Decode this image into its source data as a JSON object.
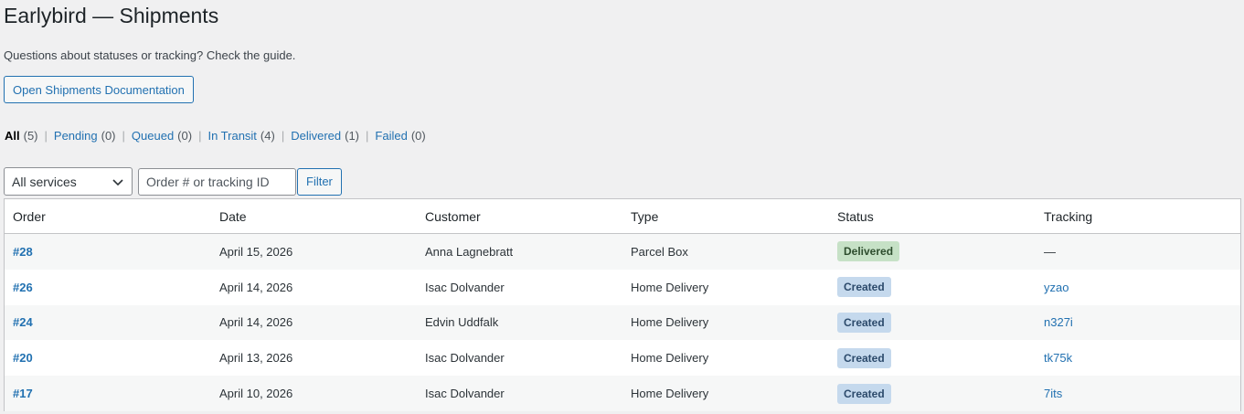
{
  "header": {
    "title": "Earlybird — Shipments",
    "intro": "Questions about statuses or tracking? Check the guide.",
    "doc_button": "Open Shipments Documentation"
  },
  "views": [
    {
      "label": "All",
      "count": "(5)",
      "current": true
    },
    {
      "label": "Pending",
      "count": "(0)"
    },
    {
      "label": "Queued",
      "count": "(0)"
    },
    {
      "label": "In Transit",
      "count": "(4)"
    },
    {
      "label": "Delivered",
      "count": "(1)"
    },
    {
      "label": "Failed",
      "count": "(0)"
    }
  ],
  "filters": {
    "service_selected": "All services",
    "search_placeholder": "Order # or tracking ID",
    "filter_label": "Filter"
  },
  "table": {
    "columns": [
      "Order",
      "Date",
      "Customer",
      "Type",
      "Status",
      "Tracking"
    ],
    "rows": [
      {
        "order": "#28",
        "date": "April 15, 2026",
        "customer": "Anna Lagnebratt",
        "type": "Parcel Box",
        "status": "Delivered",
        "status_kind": "delivered",
        "tracking": "—",
        "tracking_link": false
      },
      {
        "order": "#26",
        "date": "April 14, 2026",
        "customer": "Isac Dolvander",
        "type": "Home Delivery",
        "status": "Created",
        "status_kind": "created",
        "tracking": "yzao",
        "tracking_link": true
      },
      {
        "order": "#24",
        "date": "April 14, 2026",
        "customer": "Edvin Uddfalk",
        "type": "Home Delivery",
        "status": "Created",
        "status_kind": "created",
        "tracking": "n327i",
        "tracking_link": true
      },
      {
        "order": "#20",
        "date": "April 13, 2026",
        "customer": "Isac Dolvander",
        "type": "Home Delivery",
        "status": "Created",
        "status_kind": "created",
        "tracking": "tk75k",
        "tracking_link": true
      },
      {
        "order": "#17",
        "date": "April 10, 2026",
        "customer": "Isac Dolvander",
        "type": "Home Delivery",
        "status": "Created",
        "status_kind": "created",
        "tracking": "7its",
        "tracking_link": true
      }
    ]
  },
  "colors": {
    "link": "#2271b1",
    "background": "#f0f0f1",
    "delivered_badge": "#c6e1c6",
    "created_badge": "#c5d9ed"
  },
  "icons": {
    "select_arrow": "chevron-down-icon"
  }
}
